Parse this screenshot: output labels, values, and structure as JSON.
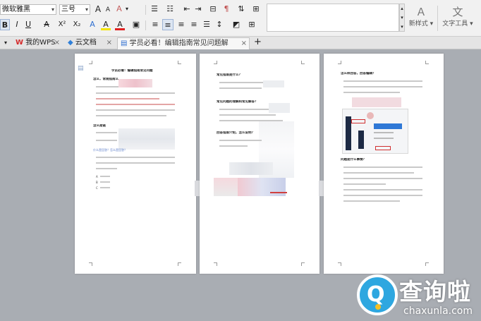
{
  "ribbon": {
    "font_name": "微软雅黑",
    "font_size": "三号",
    "grow_font": "A",
    "shrink_font": "A",
    "clear_format": "Ａ",
    "bold": "B",
    "italic": "I",
    "underline": "U",
    "strike": "A",
    "superscript": "X²",
    "subscript": "X₂",
    "font_color_label": "A",
    "highlight_label": "A",
    "bullets_icon": "☰",
    "numbering_icon": "☷",
    "sort_icon": "⇅",
    "show_marks_icon": "¶",
    "table_icon": "⊞",
    "new_style_label": "新样式",
    "text_tools_label": "文字工具"
  },
  "tabs": [
    {
      "label": "我的WPS"
    },
    {
      "label": "云文档"
    },
    {
      "label": "学员必看！编辑指南常见问题解答.docx"
    }
  ],
  "tab_add": "+",
  "tab_close": "×",
  "menu_arrow": "▾",
  "pages": {
    "p1": {
      "title": "学员必看！编辑指南常见问题",
      "s1": "怎么，常规指南么",
      "s2": "怎么是链",
      "s3": "什么是回答？怎么是回答？",
      "opt1": "A",
      "opt2": "B",
      "opt3": "C"
    },
    "p2": {
      "h1": "常见指南是什么？",
      "h2": "常见问题的理解和常见解答？",
      "h3": "回答指南介绍，怎么说明？"
    },
    "p3": {
      "h1": "怎么样回答，回答编辑？",
      "h2": "问题是什么事情？"
    }
  },
  "watermark": {
    "title": "查询啦",
    "subtitle": "chaxunla.com"
  }
}
